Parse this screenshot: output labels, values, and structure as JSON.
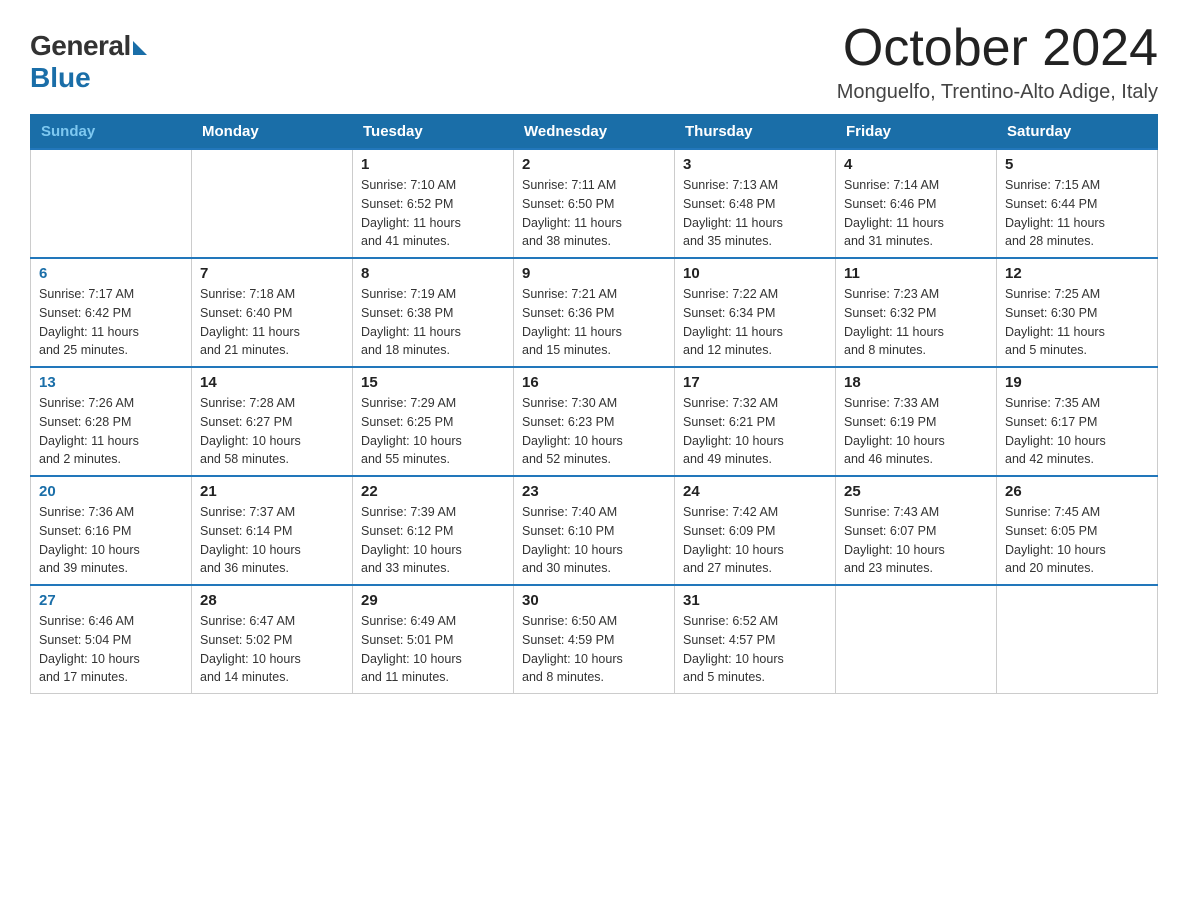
{
  "header": {
    "logo_general": "General",
    "logo_blue": "Blue",
    "title": "October 2024",
    "subtitle": "Monguelfo, Trentino-Alto Adige, Italy"
  },
  "weekdays": [
    "Sunday",
    "Monday",
    "Tuesday",
    "Wednesday",
    "Thursday",
    "Friday",
    "Saturday"
  ],
  "weeks": [
    [
      {
        "day": "",
        "info": ""
      },
      {
        "day": "",
        "info": ""
      },
      {
        "day": "1",
        "info": "Sunrise: 7:10 AM\nSunset: 6:52 PM\nDaylight: 11 hours\nand 41 minutes."
      },
      {
        "day": "2",
        "info": "Sunrise: 7:11 AM\nSunset: 6:50 PM\nDaylight: 11 hours\nand 38 minutes."
      },
      {
        "day": "3",
        "info": "Sunrise: 7:13 AM\nSunset: 6:48 PM\nDaylight: 11 hours\nand 35 minutes."
      },
      {
        "day": "4",
        "info": "Sunrise: 7:14 AM\nSunset: 6:46 PM\nDaylight: 11 hours\nand 31 minutes."
      },
      {
        "day": "5",
        "info": "Sunrise: 7:15 AM\nSunset: 6:44 PM\nDaylight: 11 hours\nand 28 minutes."
      }
    ],
    [
      {
        "day": "6",
        "info": "Sunrise: 7:17 AM\nSunset: 6:42 PM\nDaylight: 11 hours\nand 25 minutes."
      },
      {
        "day": "7",
        "info": "Sunrise: 7:18 AM\nSunset: 6:40 PM\nDaylight: 11 hours\nand 21 minutes."
      },
      {
        "day": "8",
        "info": "Sunrise: 7:19 AM\nSunset: 6:38 PM\nDaylight: 11 hours\nand 18 minutes."
      },
      {
        "day": "9",
        "info": "Sunrise: 7:21 AM\nSunset: 6:36 PM\nDaylight: 11 hours\nand 15 minutes."
      },
      {
        "day": "10",
        "info": "Sunrise: 7:22 AM\nSunset: 6:34 PM\nDaylight: 11 hours\nand 12 minutes."
      },
      {
        "day": "11",
        "info": "Sunrise: 7:23 AM\nSunset: 6:32 PM\nDaylight: 11 hours\nand 8 minutes."
      },
      {
        "day": "12",
        "info": "Sunrise: 7:25 AM\nSunset: 6:30 PM\nDaylight: 11 hours\nand 5 minutes."
      }
    ],
    [
      {
        "day": "13",
        "info": "Sunrise: 7:26 AM\nSunset: 6:28 PM\nDaylight: 11 hours\nand 2 minutes."
      },
      {
        "day": "14",
        "info": "Sunrise: 7:28 AM\nSunset: 6:27 PM\nDaylight: 10 hours\nand 58 minutes."
      },
      {
        "day": "15",
        "info": "Sunrise: 7:29 AM\nSunset: 6:25 PM\nDaylight: 10 hours\nand 55 minutes."
      },
      {
        "day": "16",
        "info": "Sunrise: 7:30 AM\nSunset: 6:23 PM\nDaylight: 10 hours\nand 52 minutes."
      },
      {
        "day": "17",
        "info": "Sunrise: 7:32 AM\nSunset: 6:21 PM\nDaylight: 10 hours\nand 49 minutes."
      },
      {
        "day": "18",
        "info": "Sunrise: 7:33 AM\nSunset: 6:19 PM\nDaylight: 10 hours\nand 46 minutes."
      },
      {
        "day": "19",
        "info": "Sunrise: 7:35 AM\nSunset: 6:17 PM\nDaylight: 10 hours\nand 42 minutes."
      }
    ],
    [
      {
        "day": "20",
        "info": "Sunrise: 7:36 AM\nSunset: 6:16 PM\nDaylight: 10 hours\nand 39 minutes."
      },
      {
        "day": "21",
        "info": "Sunrise: 7:37 AM\nSunset: 6:14 PM\nDaylight: 10 hours\nand 36 minutes."
      },
      {
        "day": "22",
        "info": "Sunrise: 7:39 AM\nSunset: 6:12 PM\nDaylight: 10 hours\nand 33 minutes."
      },
      {
        "day": "23",
        "info": "Sunrise: 7:40 AM\nSunset: 6:10 PM\nDaylight: 10 hours\nand 30 minutes."
      },
      {
        "day": "24",
        "info": "Sunrise: 7:42 AM\nSunset: 6:09 PM\nDaylight: 10 hours\nand 27 minutes."
      },
      {
        "day": "25",
        "info": "Sunrise: 7:43 AM\nSunset: 6:07 PM\nDaylight: 10 hours\nand 23 minutes."
      },
      {
        "day": "26",
        "info": "Sunrise: 7:45 AM\nSunset: 6:05 PM\nDaylight: 10 hours\nand 20 minutes."
      }
    ],
    [
      {
        "day": "27",
        "info": "Sunrise: 6:46 AM\nSunset: 5:04 PM\nDaylight: 10 hours\nand 17 minutes."
      },
      {
        "day": "28",
        "info": "Sunrise: 6:47 AM\nSunset: 5:02 PM\nDaylight: 10 hours\nand 14 minutes."
      },
      {
        "day": "29",
        "info": "Sunrise: 6:49 AM\nSunset: 5:01 PM\nDaylight: 10 hours\nand 11 minutes."
      },
      {
        "day": "30",
        "info": "Sunrise: 6:50 AM\nSunset: 4:59 PM\nDaylight: 10 hours\nand 8 minutes."
      },
      {
        "day": "31",
        "info": "Sunrise: 6:52 AM\nSunset: 4:57 PM\nDaylight: 10 hours\nand 5 minutes."
      },
      {
        "day": "",
        "info": ""
      },
      {
        "day": "",
        "info": ""
      }
    ]
  ]
}
